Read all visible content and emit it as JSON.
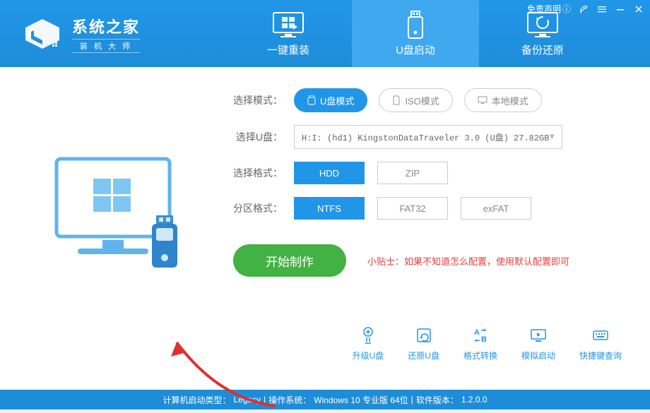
{
  "header": {
    "logo_title": "系统之家",
    "logo_sub": "装 机 大 师",
    "disclaimer": "免责声明"
  },
  "tabs": [
    {
      "label": "一键重装"
    },
    {
      "label": "U盘启动"
    },
    {
      "label": "备份还原"
    }
  ],
  "mode": {
    "label": "选择模式：",
    "options": [
      "U盘模式",
      "ISO模式",
      "本地模式"
    ]
  },
  "usb": {
    "label": "选择U盘：",
    "value": "H:I: (hd1) KingstonDataTraveler 3.0 (U盘) 27.82GB"
  },
  "format": {
    "label": "选择格式：",
    "options": [
      "HDD",
      "ZIP"
    ]
  },
  "partition": {
    "label": "分区格式：",
    "options": [
      "NTFS",
      "FAT32",
      "exFAT"
    ]
  },
  "start_label": "开始制作",
  "tip_prefix": "小贴士：",
  "tip_text": "如果不知道怎么配置，使用默认配置即可",
  "tools": [
    {
      "label": "升级U盘"
    },
    {
      "label": "还原U盘"
    },
    {
      "label": "格式转换"
    },
    {
      "label": "模拟启动"
    },
    {
      "label": "快捷键查询"
    }
  ],
  "footer": {
    "boot_type_label": "计算机启动类型：",
    "boot_type": "Legacy",
    "sep1": " | ",
    "os_label": "操作系统：",
    "os": "Windows 10 专业版 64位",
    "sep2": " | ",
    "ver_label": "软件版本：",
    "ver": "1.2.0.0"
  }
}
